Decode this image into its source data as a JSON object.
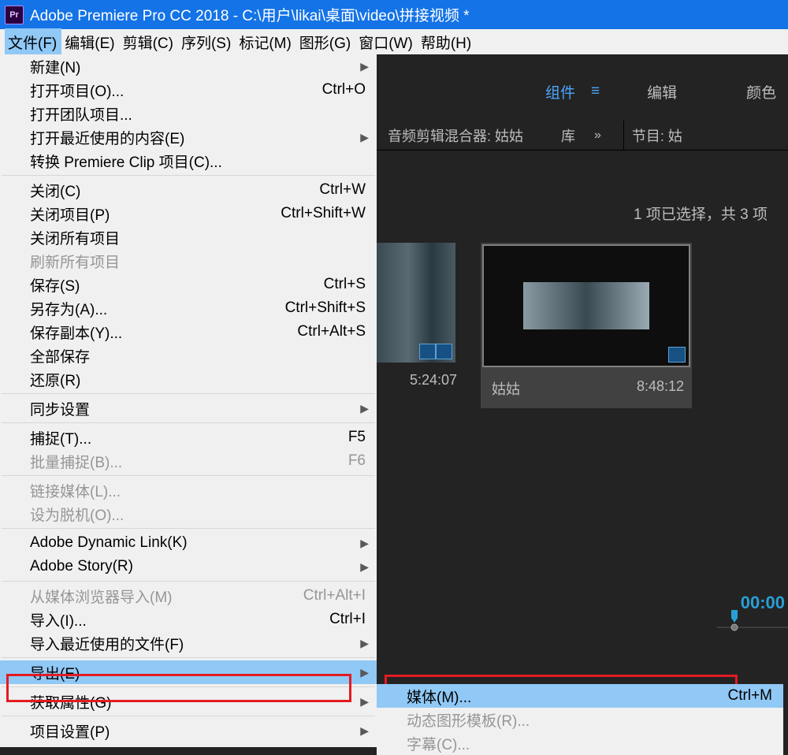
{
  "title": "Adobe Premiere Pro CC 2018 - C:\\用户\\likai\\桌面\\video\\拼接视频 *",
  "pr_icon_label": "Pr",
  "menubar": [
    "文件(F)",
    "编辑(E)",
    "剪辑(C)",
    "序列(S)",
    "标记(M)",
    "图形(G)",
    "窗口(W)",
    "帮助(H)"
  ],
  "filemenu": [
    {
      "type": "item",
      "label": "新建(N)",
      "arrow": true
    },
    {
      "type": "item",
      "label": "打开项目(O)...",
      "shortcut": "Ctrl+O"
    },
    {
      "type": "item",
      "label": "打开团队项目..."
    },
    {
      "type": "item",
      "label": "打开最近使用的内容(E)",
      "arrow": true
    },
    {
      "type": "item",
      "label": "转换 Premiere Clip 项目(C)..."
    },
    {
      "type": "sep"
    },
    {
      "type": "item",
      "label": "关闭(C)",
      "shortcut": "Ctrl+W"
    },
    {
      "type": "item",
      "label": "关闭项目(P)",
      "shortcut": "Ctrl+Shift+W"
    },
    {
      "type": "item",
      "label": "关闭所有项目"
    },
    {
      "type": "item",
      "label": "刷新所有项目",
      "disabled": true
    },
    {
      "type": "item",
      "label": "保存(S)",
      "shortcut": "Ctrl+S"
    },
    {
      "type": "item",
      "label": "另存为(A)...",
      "shortcut": "Ctrl+Shift+S"
    },
    {
      "type": "item",
      "label": "保存副本(Y)...",
      "shortcut": "Ctrl+Alt+S"
    },
    {
      "type": "item",
      "label": "全部保存"
    },
    {
      "type": "item",
      "label": "还原(R)"
    },
    {
      "type": "sep"
    },
    {
      "type": "item",
      "label": "同步设置",
      "arrow": true
    },
    {
      "type": "sep"
    },
    {
      "type": "item",
      "label": "捕捉(T)...",
      "shortcut": "F5"
    },
    {
      "type": "item",
      "label": "批量捕捉(B)...",
      "shortcut": "F6",
      "disabled": true
    },
    {
      "type": "sep"
    },
    {
      "type": "item",
      "label": "链接媒体(L)...",
      "disabled": true
    },
    {
      "type": "item",
      "label": "设为脱机(O)...",
      "disabled": true
    },
    {
      "type": "sep"
    },
    {
      "type": "item",
      "label": "Adobe Dynamic Link(K)",
      "arrow": true
    },
    {
      "type": "item",
      "label": "Adobe Story(R)",
      "arrow": true
    },
    {
      "type": "sep"
    },
    {
      "type": "item",
      "label": "从媒体浏览器导入(M)",
      "shortcut": "Ctrl+Alt+I",
      "disabled": true
    },
    {
      "type": "item",
      "label": "导入(I)...",
      "shortcut": "Ctrl+I"
    },
    {
      "type": "item",
      "label": "导入最近使用的文件(F)",
      "arrow": true
    },
    {
      "type": "sep"
    },
    {
      "type": "item",
      "label": "导出(E)",
      "arrow": true,
      "highlight": true
    },
    {
      "type": "sep"
    },
    {
      "type": "item",
      "label": "获取属性(G)",
      "arrow": true
    },
    {
      "type": "sep"
    },
    {
      "type": "item",
      "label": "项目设置(P)",
      "arrow": true
    }
  ],
  "submenu": [
    {
      "label": "媒体(M)...",
      "shortcut": "Ctrl+M",
      "highlight": true
    },
    {
      "label": "动态图形模板(R)...",
      "disabled": true
    },
    {
      "label": "字幕(C)...",
      "disabled": true
    }
  ],
  "workspaces": {
    "items": [
      "组件",
      "编辑",
      "颜色"
    ],
    "active_index": 0,
    "menu_glyph": "≡"
  },
  "panel_tabs": {
    "mixer": "音频剪辑混合器: 姑姑",
    "library": "库",
    "chevron": "»",
    "program": "节目: 姑"
  },
  "selection_text": "1 项已选择，共 3 项",
  "thumbs": [
    {
      "name": "",
      "duration": "5:24:07"
    },
    {
      "name": "姑姑",
      "duration": "8:48:12",
      "selected": true
    }
  ],
  "timeline_time": "00:00"
}
